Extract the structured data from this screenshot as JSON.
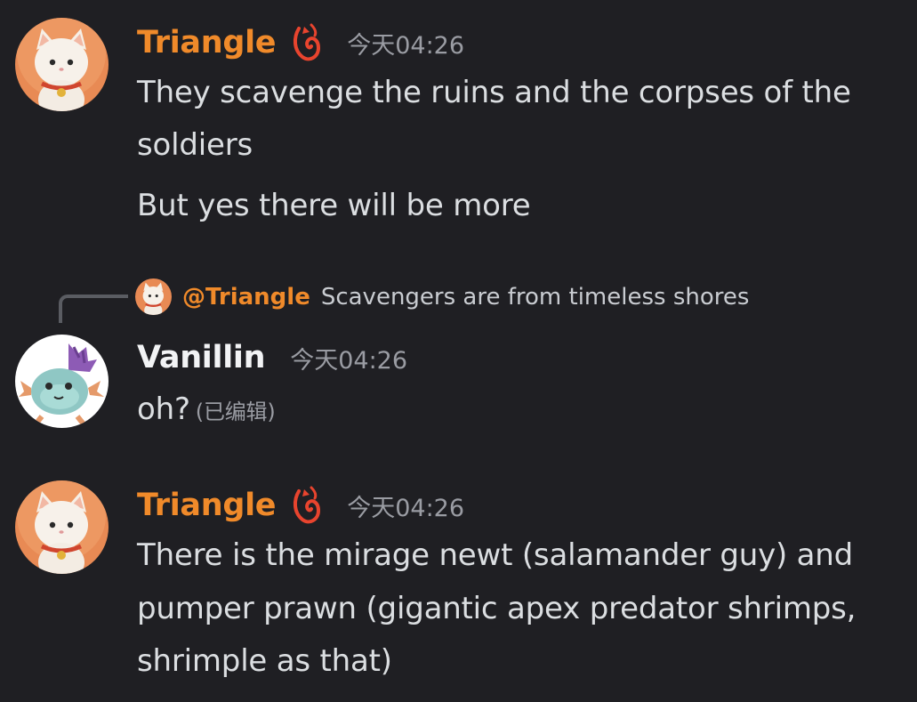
{
  "messages": [
    {
      "username": "Triangle",
      "timestamp": "今天04:26",
      "lines": [
        "They scavenge the ruins and the corpses of the",
        "soldiers",
        "But yes there will be more"
      ]
    },
    {
      "reply": {
        "mention": "@Triangle",
        "text": "Scavengers are from timeless shores"
      },
      "username": "Vanillin",
      "timestamp": "今天04:26",
      "lines": [
        "oh?"
      ],
      "edited": "(已编辑)"
    },
    {
      "username": "Triangle",
      "timestamp": "今天04:26",
      "lines": [
        "There is the mirage newt (salamander guy) and",
        "pumper prawn (gigantic apex predator shrimps,",
        "shrimple as that)"
      ]
    }
  ],
  "colors": {
    "background": "#1f1f23",
    "triangle_name": "#f08a2a",
    "vanillin_name": "#f2f3f5",
    "message_text": "#dbdee1",
    "timestamp": "#9a9ca3"
  },
  "icons": {
    "role_badge": "flame-spiral-badge-icon",
    "triangle_avatar": "cat-with-bell-avatar",
    "vanillin_avatar": "purple-fin-axolotl-avatar"
  }
}
